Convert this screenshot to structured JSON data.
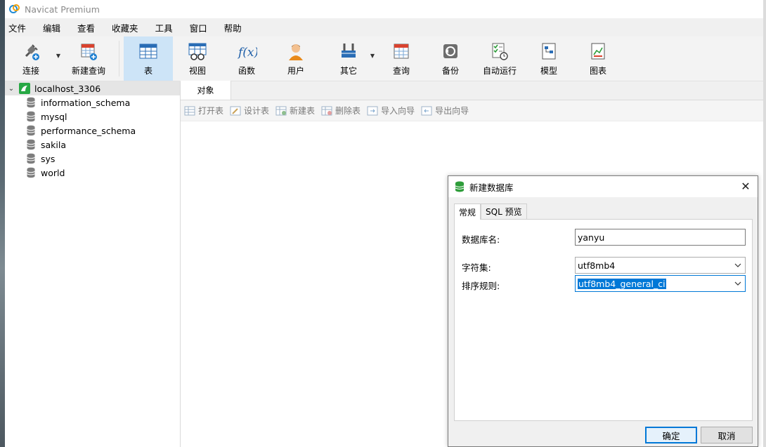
{
  "app": {
    "title": "Navicat Premium"
  },
  "menu": [
    "文件",
    "编辑",
    "查看",
    "收藏夹",
    "工具",
    "窗口",
    "帮助"
  ],
  "toolbar": {
    "connect": "连接",
    "new_query": "新建查询",
    "table": "表",
    "view": "视图",
    "function": "函数",
    "user": "用户",
    "other": "其它",
    "query": "查询",
    "backup": "备份",
    "automation": "自动运行",
    "model": "模型",
    "chart": "图表"
  },
  "sidebar": {
    "connection": "localhost_3306",
    "databases": [
      "information_schema",
      "mysql",
      "performance_schema",
      "sakila",
      "sys",
      "world"
    ]
  },
  "main": {
    "tab": "对象",
    "object_actions": [
      "打开表",
      "设计表",
      "新建表",
      "删除表",
      "导入向导",
      "导出向导"
    ]
  },
  "dialog": {
    "title": "新建数据库",
    "close": "✕",
    "tabs": [
      "常规",
      "SQL 预览"
    ],
    "db_name_label": "数据库名:",
    "db_name_value": "yanyu",
    "charset_label": "字符集:",
    "charset_value": "utf8mb4",
    "collation_label": "排序规则:",
    "collation_value": "utf8mb4_general_ci",
    "ok": "确定",
    "cancel": "取消"
  },
  "colors": {
    "accent": "#0078d7",
    "active_tool": "#cde4f7",
    "db_green": "#2e9d3a"
  }
}
